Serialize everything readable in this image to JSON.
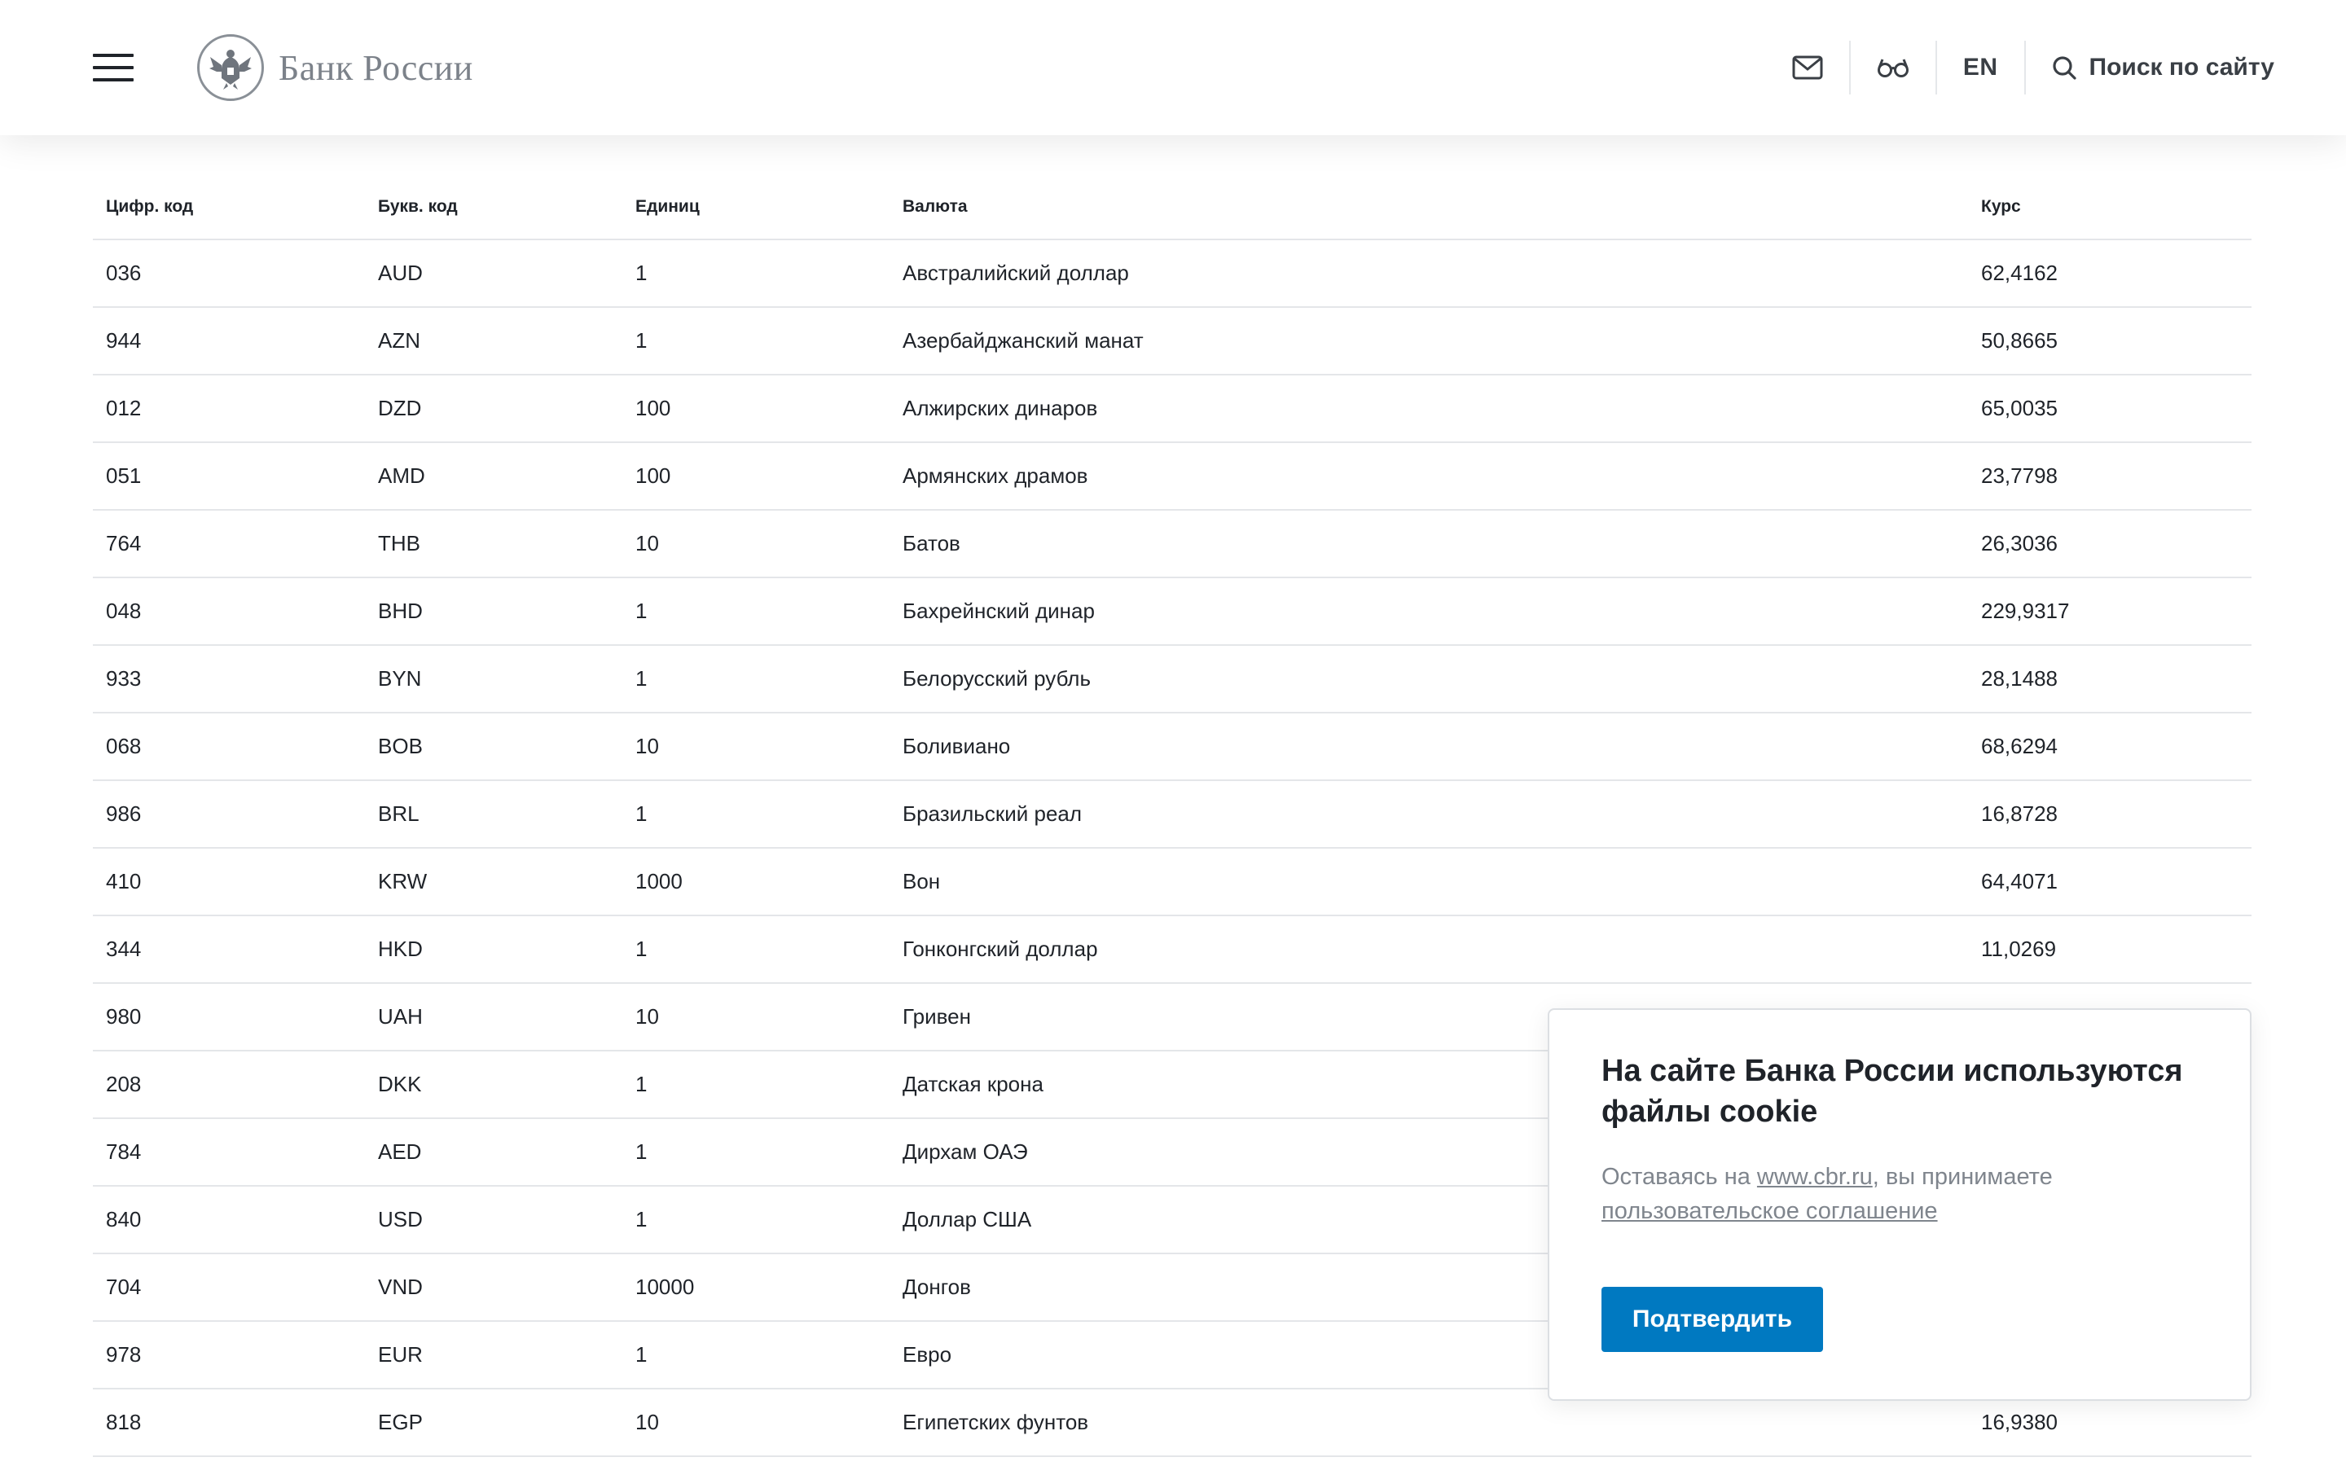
{
  "header": {
    "logo_text": "Банк России",
    "lang_label": "EN",
    "search_label": "Поиск по сайту"
  },
  "table": {
    "columns": [
      "Цифр. код",
      "Букв. код",
      "Единиц",
      "Валюта",
      "Курс"
    ],
    "rows": [
      {
        "num": "036",
        "code": "AUD",
        "units": "1",
        "name": "Австралийский доллар",
        "rate": "62,4162"
      },
      {
        "num": "944",
        "code": "AZN",
        "units": "1",
        "name": "Азербайджанский манат",
        "rate": "50,8665"
      },
      {
        "num": "012",
        "code": "DZD",
        "units": "100",
        "name": "Алжирских динаров",
        "rate": "65,0035"
      },
      {
        "num": "051",
        "code": "AMD",
        "units": "100",
        "name": "Армянских драмов",
        "rate": "23,7798"
      },
      {
        "num": "764",
        "code": "THB",
        "units": "10",
        "name": "Батов",
        "rate": "26,3036"
      },
      {
        "num": "048",
        "code": "BHD",
        "units": "1",
        "name": "Бахрейнский динар",
        "rate": "229,9317"
      },
      {
        "num": "933",
        "code": "BYN",
        "units": "1",
        "name": "Белорусский рубль",
        "rate": "28,1488"
      },
      {
        "num": "068",
        "code": "BOB",
        "units": "10",
        "name": "Боливиано",
        "rate": "68,6294"
      },
      {
        "num": "986",
        "code": "BRL",
        "units": "1",
        "name": "Бразильский реал",
        "rate": "16,8728"
      },
      {
        "num": "410",
        "code": "KRW",
        "units": "1000",
        "name": "Вон",
        "rate": "64,4071"
      },
      {
        "num": "344",
        "code": "HKD",
        "units": "1",
        "name": "Гонконгский доллар",
        "rate": "11,0269"
      },
      {
        "num": "980",
        "code": "UAH",
        "units": "10",
        "name": "Гривен",
        "rate": ""
      },
      {
        "num": "208",
        "code": "DKK",
        "units": "1",
        "name": "Датская крона",
        "rate": ""
      },
      {
        "num": "784",
        "code": "AED",
        "units": "1",
        "name": "Дирхам ОАЭ",
        "rate": ""
      },
      {
        "num": "840",
        "code": "USD",
        "units": "1",
        "name": "Доллар США",
        "rate": ""
      },
      {
        "num": "704",
        "code": "VND",
        "units": "10000",
        "name": "Донгов",
        "rate": ""
      },
      {
        "num": "978",
        "code": "EUR",
        "units": "1",
        "name": "Евро",
        "rate": ""
      },
      {
        "num": "818",
        "code": "EGP",
        "units": "10",
        "name": "Египетских фунтов",
        "rate": "16,9380"
      }
    ]
  },
  "cookie": {
    "title": "На сайте Банка России используются файлы cookie",
    "text_prefix": "Оставаясь на ",
    "site_link": "www.cbr.ru",
    "text_middle": ", вы принимаете",
    "agreement_link": "пользовательское соглашение",
    "confirm_label": "Подтвердить"
  },
  "colors": {
    "accent": "#0079c1",
    "muted_text": "#7f858d",
    "divider": "#e4e6e9"
  },
  "icons": [
    "menu-icon",
    "bank-emblem-icon",
    "mail-icon",
    "glasses-icon",
    "search-icon"
  ]
}
